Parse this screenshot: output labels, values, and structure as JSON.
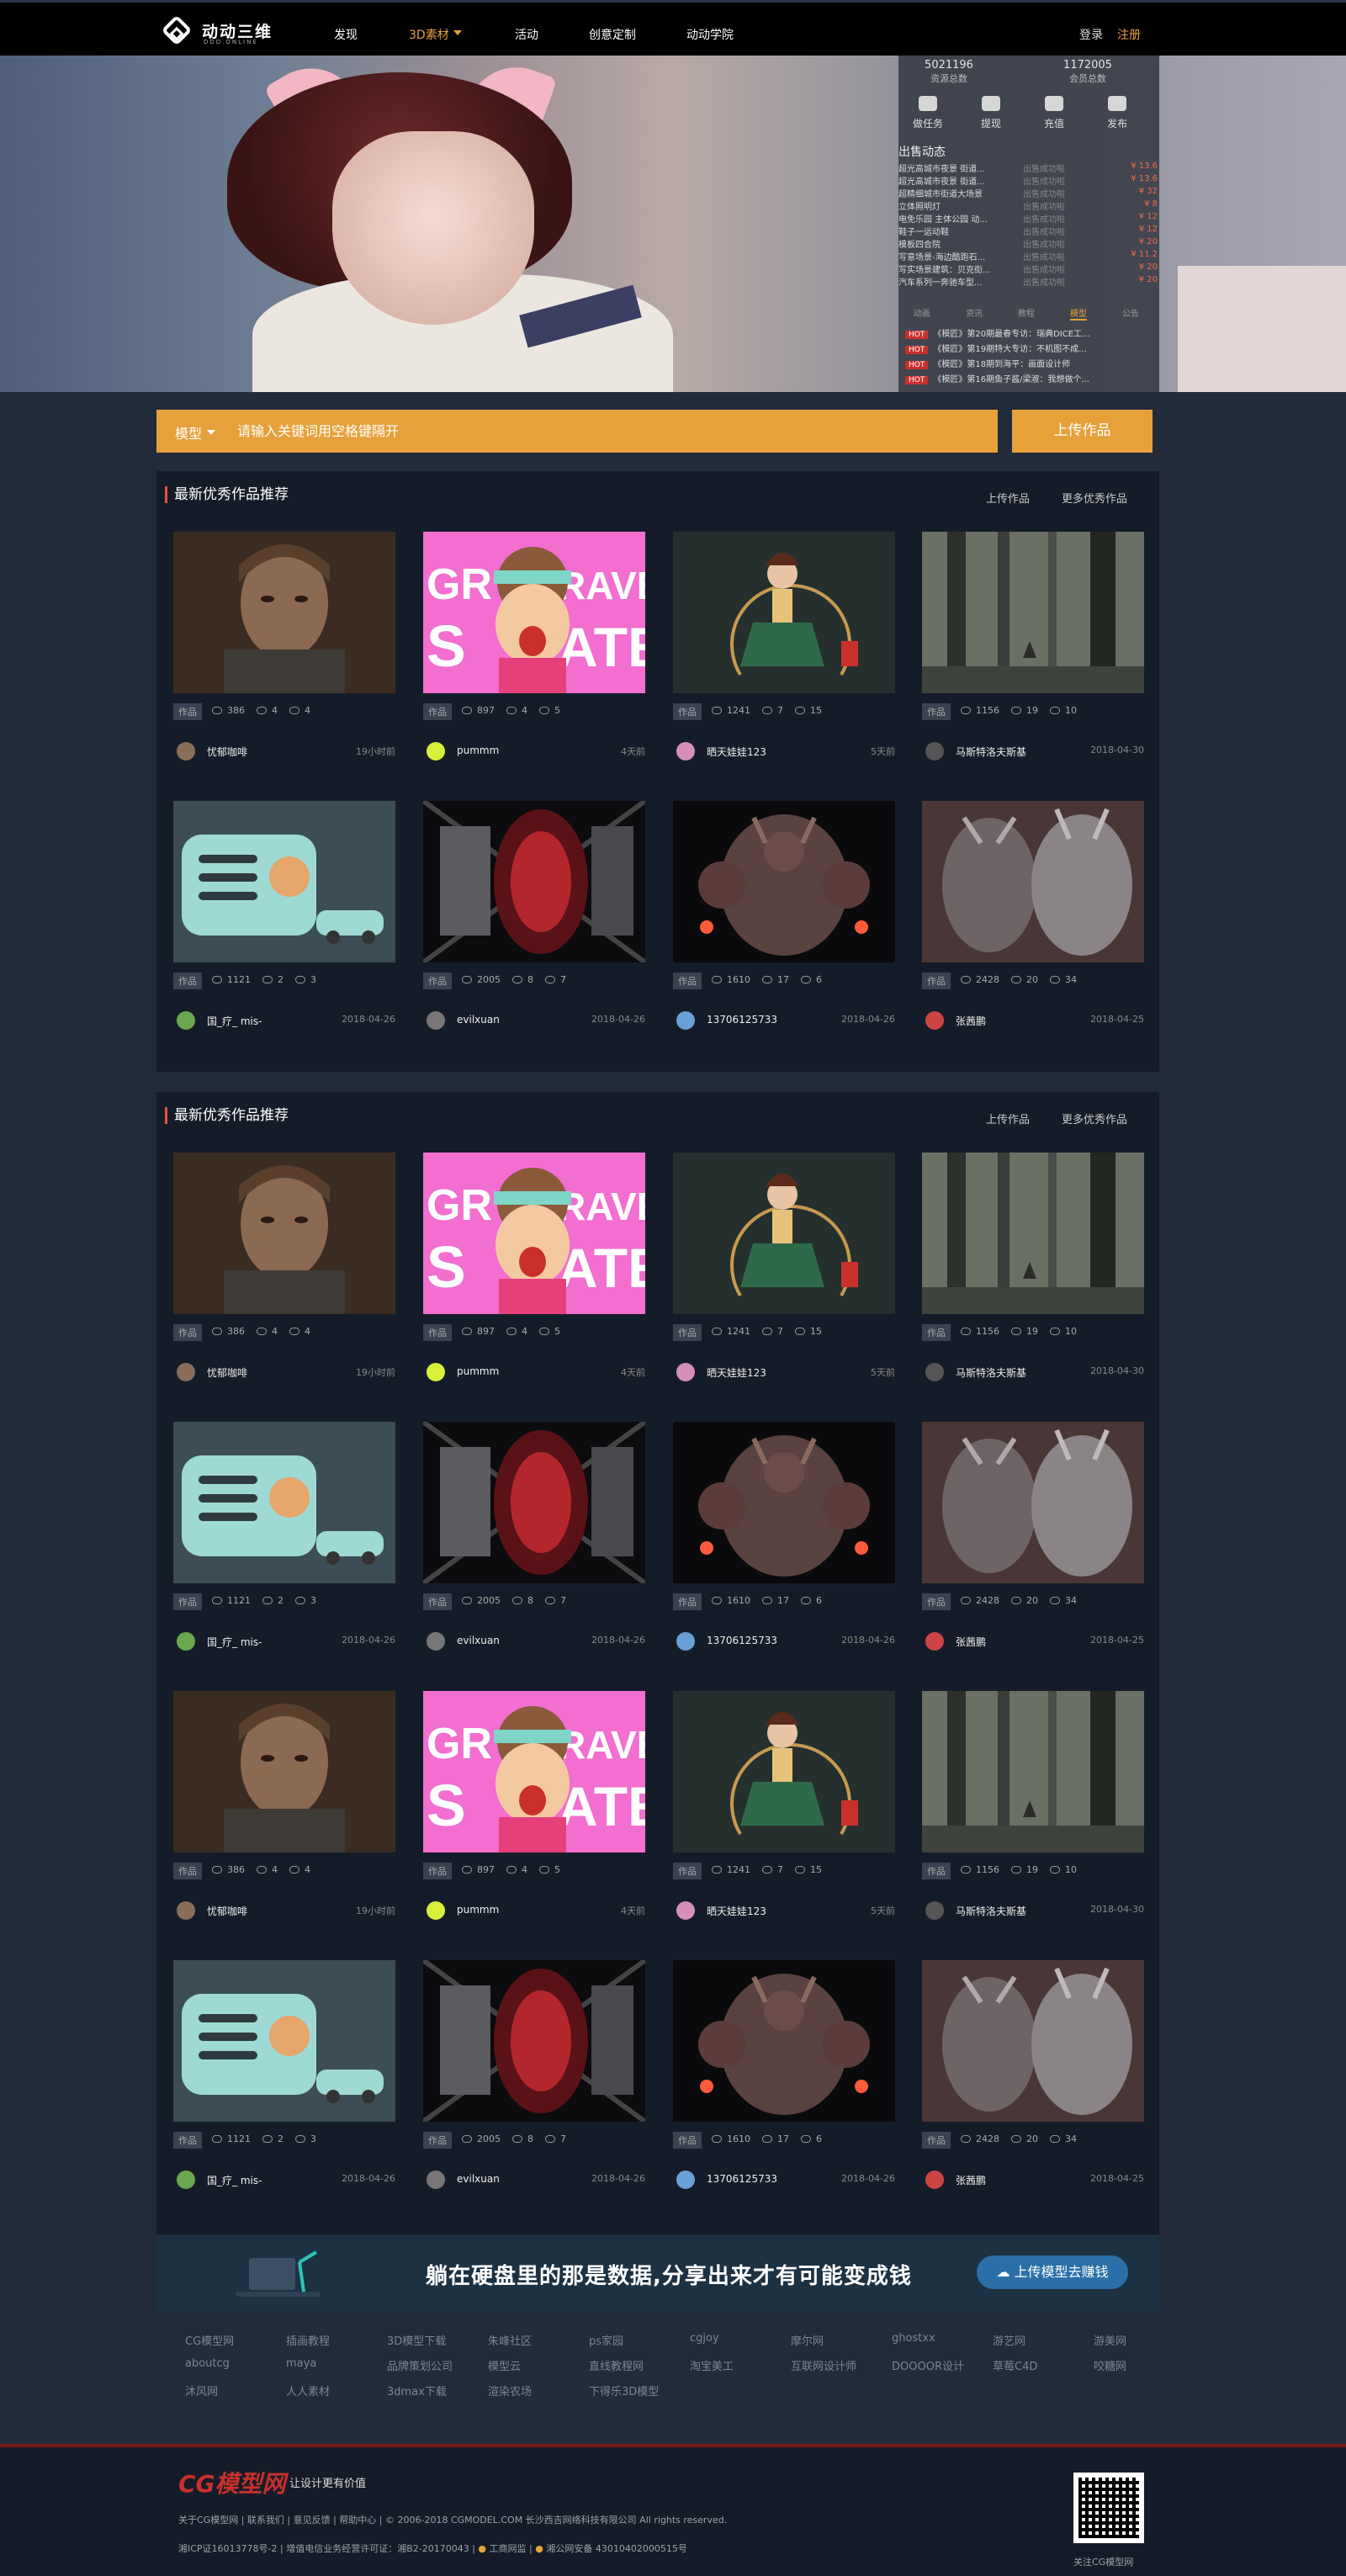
{
  "header": {
    "logo_text": "动动三维",
    "logo_sub": "DDD.ONLINE",
    "nav": [
      "发现",
      "3D素材",
      "活动",
      "创意定制",
      "动动学院"
    ],
    "login": "登录",
    "register": "注册"
  },
  "panel": {
    "stats": [
      {
        "value": "5021196",
        "label": "资源总数"
      },
      {
        "value": "1172005",
        "label": "会员总数"
      }
    ],
    "actions": [
      "做任务",
      "提现",
      "充值",
      "发布"
    ],
    "title": "出售动态",
    "sales": [
      {
        "name": "超光高城市夜景 街道...",
        "user": "出售成功啦",
        "price": "¥ 13.6"
      },
      {
        "name": "超光高城市夜景 街道...",
        "user": "出售成功啦",
        "price": "¥ 13.6"
      },
      {
        "name": "超精细城市街道大场景",
        "user": "出售成功啦",
        "price": "¥ 32"
      },
      {
        "name": "立体照明灯",
        "user": "出售成功啦",
        "price": "¥ 8"
      },
      {
        "name": "电免乐园 主体公园 动...",
        "user": "出售成功啦",
        "price": "¥ 12"
      },
      {
        "name": "鞋子一运动鞋",
        "user": "出售成功啦",
        "price": "¥ 12"
      },
      {
        "name": "模板四合院",
        "user": "出售成功啦",
        "price": "¥ 20"
      },
      {
        "name": "写意场景-海边酷跑石...",
        "user": "出售成功啦",
        "price": "¥ 11.2"
      },
      {
        "name": "写实场景建筑：贝克街...",
        "user": "出售成功啦",
        "price": "¥ 20"
      },
      {
        "name": "汽车系列一奔驰车型...",
        "user": "出售成功啦",
        "price": "¥ 20"
      }
    ],
    "tabs": [
      "动画",
      "资讯",
      "教程",
      "模型",
      "公告"
    ],
    "news": [
      {
        "tag": "HOT",
        "text": "《模匠》第20期最春专访：瑞典DICE工..."
      },
      {
        "tag": "HOT",
        "text": "《模匠》第19期特大专访：不机图不成..."
      },
      {
        "tag": "HOT",
        "text": "《模匠》第18期到海平：画面设计师"
      },
      {
        "tag": "HOT",
        "text": "《模匠》第16期鱼子酱/梁淑：我想做个..."
      }
    ]
  },
  "search": {
    "category": "模型",
    "placeholder": "请输入关键词用空格键隔开",
    "upload_button": "上传作品"
  },
  "sections": [
    {
      "title": "最新优秀作品推荐",
      "upload_link": "上传作品",
      "more_link": "更多优秀作品"
    },
    {
      "title": "最新优秀作品推荐",
      "upload_link": "上传作品",
      "more_link": "更多优秀作品"
    }
  ],
  "cards": [
    {
      "tag": "作品",
      "views": "386",
      "comments": "4",
      "likes": "4",
      "user": "忧郁咖啡",
      "date": "19小时前",
      "img": "man",
      "avatar_color": "#8a6e5a"
    },
    {
      "tag": "作品",
      "views": "897",
      "comments": "4",
      "likes": "5",
      "user": "pummm",
      "date": "4天前",
      "img": "skate",
      "avatar_color": "#d8f03a",
      "img_text": [
        "GR",
        "RAVEL",
        "S",
        "ATE"
      ]
    },
    {
      "tag": "作品",
      "views": "1241",
      "comments": "7",
      "likes": "15",
      "user": "晒天娃娃123",
      "date": "5天前",
      "img": "girl",
      "avatar_color": "#d58fb8"
    },
    {
      "tag": "作品",
      "views": "1156",
      "comments": "19",
      "likes": "10",
      "user": "马斯特洛夫斯基",
      "date": "2018-04-30",
      "img": "forest",
      "avatar_color": "#555"
    },
    {
      "tag": "作品",
      "views": "1121",
      "comments": "2",
      "likes": "3",
      "user": "国_疗_ mis-",
      "date": "2018-04-26",
      "img": "radio",
      "avatar_color": "#6aa84f"
    },
    {
      "tag": "作品",
      "views": "2005",
      "comments": "8",
      "likes": "7",
      "user": "evilxuan",
      "date": "2018-04-26",
      "img": "robot",
      "avatar_color": "#777"
    },
    {
      "tag": "作品",
      "views": "1610",
      "comments": "17",
      "likes": "6",
      "user": "13706125733",
      "date": "2018-04-26",
      "img": "armor",
      "avatar_color": "#6aa0d8"
    },
    {
      "tag": "作品",
      "views": "2428",
      "comments": "20",
      "likes": "34",
      "user": "张茜鹏",
      "date": "2018-04-25",
      "img": "beast",
      "avatar_color": "#c44"
    }
  ],
  "banner": {
    "text": "躺在硬盘里的那是数据,分享出来才有可能变成钱",
    "button": "上传模型去赚钱"
  },
  "links": [
    [
      "CG模型网",
      "插画教程",
      "3D模型下载",
      "朱峰社区",
      "ps家园",
      "cgjoy",
      "摩尔网",
      "ghostxx",
      "游艺网",
      "游美网"
    ],
    [
      "aboutcg",
      "maya",
      "品牌策划公司",
      "模型云",
      "直线教程网",
      "淘宝美工",
      "互联网设计师",
      "DOOOOR设计",
      "草莓C4D",
      "咬糖网"
    ],
    [
      "沐风网",
      "人人素材",
      "3dmax下载",
      "渲染农场",
      "下得乐3D模型"
    ]
  ],
  "footer": {
    "logo": "CG模型网",
    "slogan": "让设计更有价值",
    "line1": "关于CG模型网 | 联系我们 | 意见反馈 | 帮助中心 | © 2006-2018 CGMODEL.COM 长沙西吉网络科技有限公司 All rights reserved.",
    "line2": "湘ICP证16013778号-2 | 增值电信业务经营许可证：湘B2-20170043 |",
    "badge1": "工商网监",
    "badge2": "湘公网安备 43010402000515号",
    "qr_text": "关注CG模型网"
  },
  "colors": {
    "accent": "#e7a13b",
    "page_bg": "#212b3a",
    "section_bg": "#151c29",
    "hot": "#c9302c"
  }
}
